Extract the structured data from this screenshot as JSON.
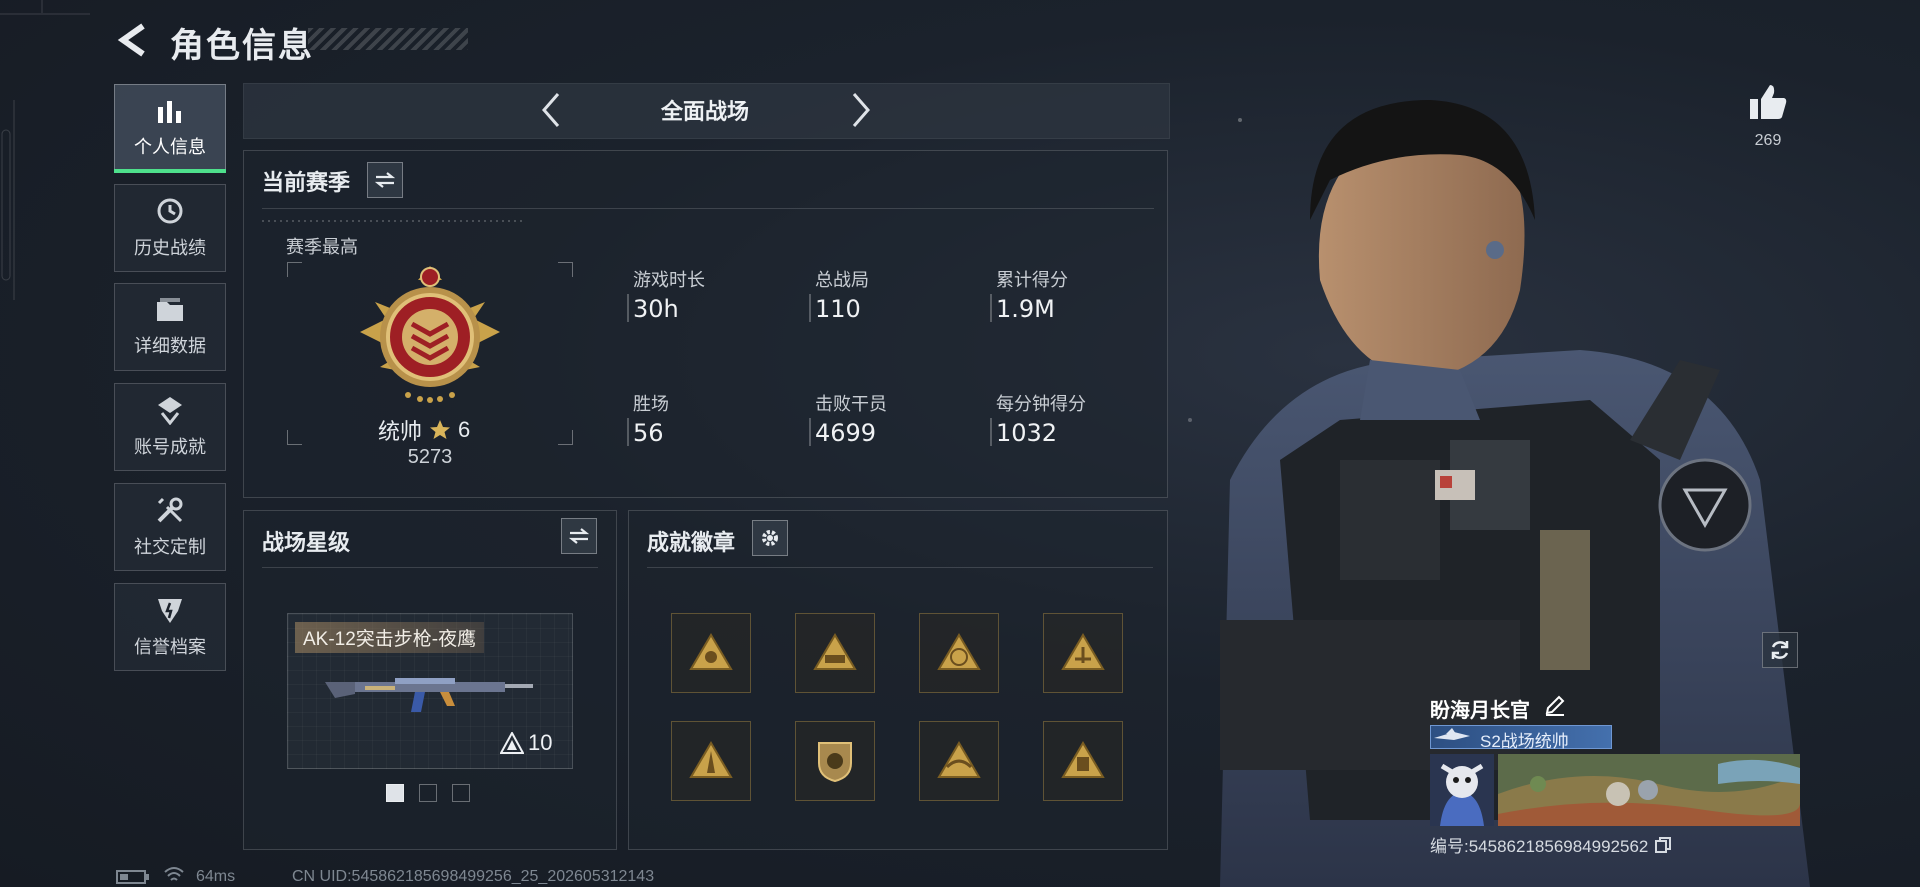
{
  "header": {
    "title": "角色信息"
  },
  "sidebar": {
    "items": [
      {
        "label": "个人信息",
        "icon": "bar-chart-icon",
        "active": true
      },
      {
        "label": "历史战绩",
        "icon": "history-clock-icon"
      },
      {
        "label": "详细数据",
        "icon": "folder-icon"
      },
      {
        "label": "账号成就",
        "icon": "achievement-medal-icon"
      },
      {
        "label": "社交定制",
        "icon": "tools-wrench-icon"
      },
      {
        "label": "信誉档案",
        "icon": "credit-shield-icon"
      }
    ]
  },
  "mode": {
    "label": "全面战场"
  },
  "season": {
    "title": "当前赛季",
    "best_label": "赛季最高",
    "rank_name": "统帅",
    "rank_stars": "6",
    "rank_points": "5273",
    "stats": [
      {
        "label": "游戏时长",
        "value": "30h"
      },
      {
        "label": "总战局",
        "value": "110"
      },
      {
        "label": "累计得分",
        "value": "1.9M"
      },
      {
        "label": "胜场",
        "value": "56"
      },
      {
        "label": "击败干员",
        "value": "4699"
      },
      {
        "label": "每分钟得分",
        "value": "1032"
      }
    ]
  },
  "star_level": {
    "title": "战场星级",
    "weapon_name": "AK-12突击步枪-夜鹰",
    "weapon_level": "10",
    "page_count": 3,
    "current_page": 1
  },
  "badges": {
    "title": "成就徽章",
    "items": [
      "badge-soldier-icon",
      "badge-vehicle-icon",
      "badge-globe-icon",
      "badge-radar-icon",
      "badge-tower-icon",
      "badge-shield-icon",
      "badge-eagle-icon",
      "badge-fortress-icon"
    ]
  },
  "character": {
    "likes": "269",
    "player_name": "盼海月长官",
    "rank_title": "S2战场统帅",
    "id_text": "编号:5458621856984992562"
  },
  "footer": {
    "ping": "64ms",
    "uid_text": "CN UID:545862185698499256_25_202605312143"
  },
  "colors": {
    "accent_green": "#4ee08c",
    "rank_blue": "#4470ad",
    "gold": "#c9a24a"
  }
}
